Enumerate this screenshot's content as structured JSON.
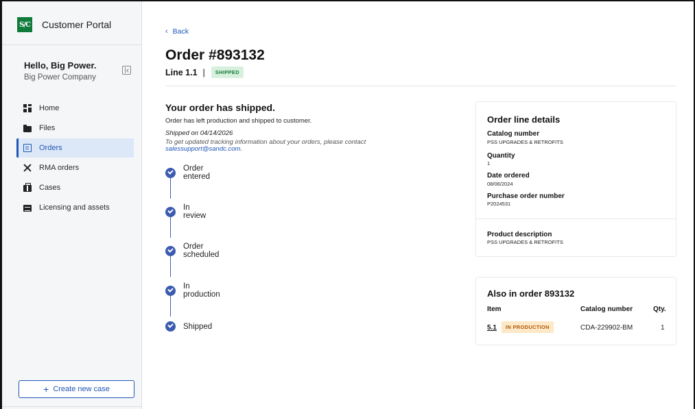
{
  "sidebar": {
    "logo_text": "S/C",
    "app_title": "Customer Portal",
    "greeting": "Hello, Big Power.",
    "company": "Big Power Company",
    "nav": [
      {
        "label": "Home",
        "icon": "home-icon"
      },
      {
        "label": "Files",
        "icon": "folder-icon"
      },
      {
        "label": "Orders",
        "icon": "orders-icon",
        "active": true
      },
      {
        "label": "RMA orders",
        "icon": "tools-icon"
      },
      {
        "label": "Cases",
        "icon": "briefcase-icon"
      },
      {
        "label": "Licensing and assets",
        "icon": "license-icon"
      }
    ],
    "create_case_label": "Create new case"
  },
  "header": {
    "back_label": "Back",
    "order_title": "Order #893132",
    "line_label": "Line 1.1",
    "separator": "|",
    "status_badge": "SHIPPED"
  },
  "status": {
    "heading": "Your order has shipped.",
    "description": "Order has left production and shipped to customer.",
    "shipped_on": "Shipped on 04/14/2026",
    "contact_text": "To get updated tracking information about your orders, please contact",
    "contact_email": "salessupport@sandc.com",
    "contact_suffix": "."
  },
  "timeline": [
    {
      "label": "Order entered",
      "done": true
    },
    {
      "label": "In review",
      "done": true
    },
    {
      "label": "Order scheduled",
      "done": true
    },
    {
      "label": "In production",
      "done": true
    },
    {
      "label": "Shipped",
      "done": true
    }
  ],
  "details": {
    "title": "Order line details",
    "catalog_label": "Catalog number",
    "catalog_value": "PSS UPGRADES & RETROFITS",
    "quantity_label": "Quantity",
    "quantity_value": "1",
    "date_label": "Date ordered",
    "date_value": "08/06/2024",
    "po_label": "Purchase order number",
    "po_value": "P2024531",
    "product_label": "Product description",
    "product_value": "PSS UPGRADES & RETROFITS"
  },
  "also": {
    "title": "Also in order 893132",
    "col_item": "Item",
    "col_catalog": "Catalog number",
    "col_qty": "Qty.",
    "rows": [
      {
        "item": "5.1",
        "status": "IN PRODUCTION",
        "catalog": "CDA-229902-BM",
        "qty": "1"
      }
    ]
  },
  "colors": {
    "accent": "#1f55b8",
    "step": "#3b5bb0",
    "shipped_bg": "#d7f0de",
    "shipped_fg": "#177a3b",
    "production_bg": "#fde8c8",
    "production_fg": "#b05a0a",
    "logo_bg": "#0f7a3a"
  }
}
